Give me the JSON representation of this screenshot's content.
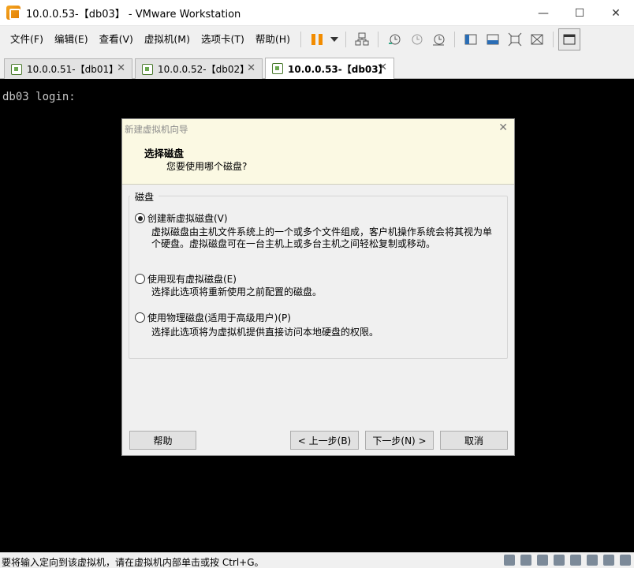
{
  "window": {
    "title": "10.0.0.53-【db03】 - VMware Workstation",
    "controls": [
      "—",
      "☐",
      "✕"
    ]
  },
  "menu": [
    "文件(F)",
    "编辑(E)",
    "查看(V)",
    "虚拟机(M)",
    "选项卡(T)",
    "帮助(H)"
  ],
  "tabs": [
    {
      "label": "10.0.0.51-【db01】",
      "active": false
    },
    {
      "label": "10.0.0.52-【db02】",
      "active": false
    },
    {
      "label": "10.0.0.53-【db03】",
      "active": true
    }
  ],
  "console": {
    "text": "db03 login:"
  },
  "dialog": {
    "title": "新建虚拟机向导",
    "heading": "选择磁盘",
    "subheading": "您要使用哪个磁盘?",
    "group_label": "磁盘",
    "options": [
      {
        "label": "创建新虚拟磁盘(V)",
        "checked": true,
        "desc_lines": [
          "虚拟磁盘由主机文件系统上的一个或多个文件组成，客户机操作系统会将其视为单",
          "个硬盘。虚拟磁盘可在一台主机上或多台主机之间轻松复制或移动。"
        ]
      },
      {
        "label": "使用现有虚拟磁盘(E)",
        "checked": false,
        "desc_lines": [
          "选择此选项将重新使用之前配置的磁盘。"
        ]
      },
      {
        "label": "使用物理磁盘(适用于高级用户)(P)",
        "checked": false,
        "desc_lines": [
          "选择此选项将为虚拟机提供直接访问本地硬盘的权限。"
        ]
      }
    ],
    "buttons": {
      "help": "帮助",
      "back": "< 上一步(B)",
      "next": "下一步(N) >",
      "cancel": "取消"
    }
  },
  "status": {
    "text": "要将输入定向到该虚拟机，请在虚拟机内部单击或按 Ctrl+G。"
  }
}
